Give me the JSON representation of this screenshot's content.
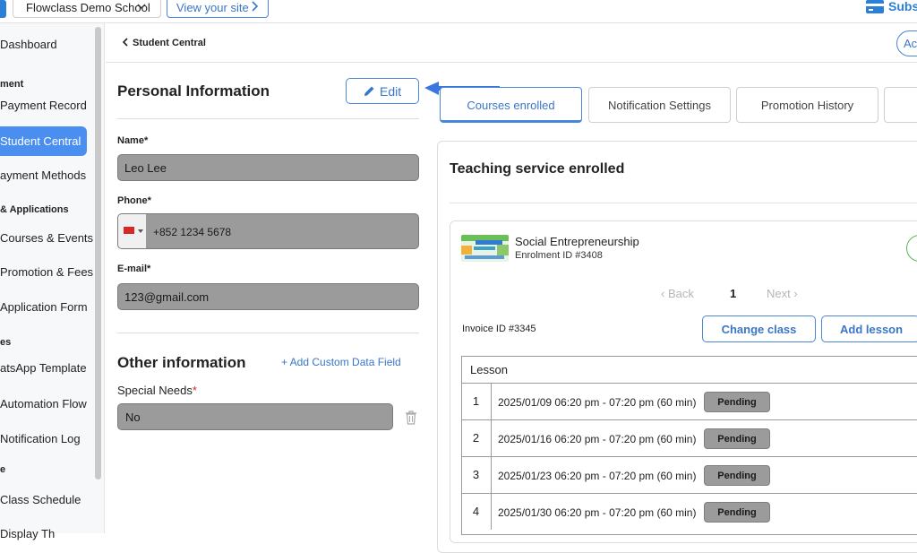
{
  "topbar": {
    "school_name": "Flowclass Demo School",
    "view_site_label": "View your site",
    "subscribe_label": "Subs"
  },
  "sidebar": {
    "items": [
      {
        "type": "item",
        "label": "Dashboard"
      },
      {
        "type": "section",
        "label": "ment"
      },
      {
        "type": "item",
        "label": "Payment Record"
      },
      {
        "type": "item",
        "label": "Student Central",
        "active": true
      },
      {
        "type": "item",
        "label": "ayment Methods"
      },
      {
        "type": "section",
        "label": "& Applications"
      },
      {
        "type": "item",
        "label": "Courses & Events"
      },
      {
        "type": "item",
        "label": "Promotion & Fees"
      },
      {
        "type": "item",
        "label": "Application Form"
      },
      {
        "type": "section",
        "label": "es"
      },
      {
        "type": "item",
        "label": "atsApp Template"
      },
      {
        "type": "item",
        "label": "Automation Flow"
      },
      {
        "type": "item",
        "label": "Notification Log"
      },
      {
        "type": "section",
        "label": "e"
      },
      {
        "type": "item",
        "label": "Class Schedule"
      },
      {
        "type": "item",
        "label": "Display Th"
      }
    ]
  },
  "header": {
    "title": "Student Central",
    "action_label": "Ac"
  },
  "personal": {
    "title": "Personal Information",
    "edit_label": "Edit",
    "name_label": "Name*",
    "name_value": "Leo Lee",
    "phone_label": "Phone*",
    "phone_value": "+852 1234 5678",
    "email_label": "E-mail*",
    "email_value": "123@gmail.com"
  },
  "other": {
    "title": "Other information",
    "add_custom_label": "+ Add Custom Data Field",
    "special_label": "Special Needs",
    "special_required": "*",
    "special_value": "No"
  },
  "tabs": [
    {
      "label": "Courses enrolled",
      "active": true
    },
    {
      "label": "Notification Settings"
    },
    {
      "label": "Promotion History"
    },
    {
      "label": ""
    }
  ],
  "teaching": {
    "title": "Teaching service enrolled",
    "course_name": "Social Entrepreneurship",
    "enrolment_id": "Enrolment ID #3408",
    "pager_back": "Back",
    "pager_page": "1",
    "pager_next": "Next",
    "invoice_id": "Invoice ID #3345",
    "change_class_label": "Change class",
    "add_lesson_label": "Add lesson",
    "lesson_header": "Lesson",
    "lessons": [
      {
        "num": "1",
        "date": "2025/01/09 06:20 pm - 07:20 pm (60 min)",
        "status": "Pending"
      },
      {
        "num": "2",
        "date": "2025/01/16 06:20 pm - 07:20 pm (60 min)",
        "status": "Pending"
      },
      {
        "num": "3",
        "date": "2025/01/23 06:20 pm - 07:20 pm (60 min)",
        "status": "Pending"
      },
      {
        "num": "4",
        "date": "2025/01/30 06:20 pm - 07:20 pm (60 min)",
        "status": "Pending"
      }
    ]
  },
  "colors": {
    "accent": "#4a86d8",
    "active_nav": "#4a8ff0",
    "readonly_field": "#9b9b9b",
    "required": "#d62828"
  }
}
